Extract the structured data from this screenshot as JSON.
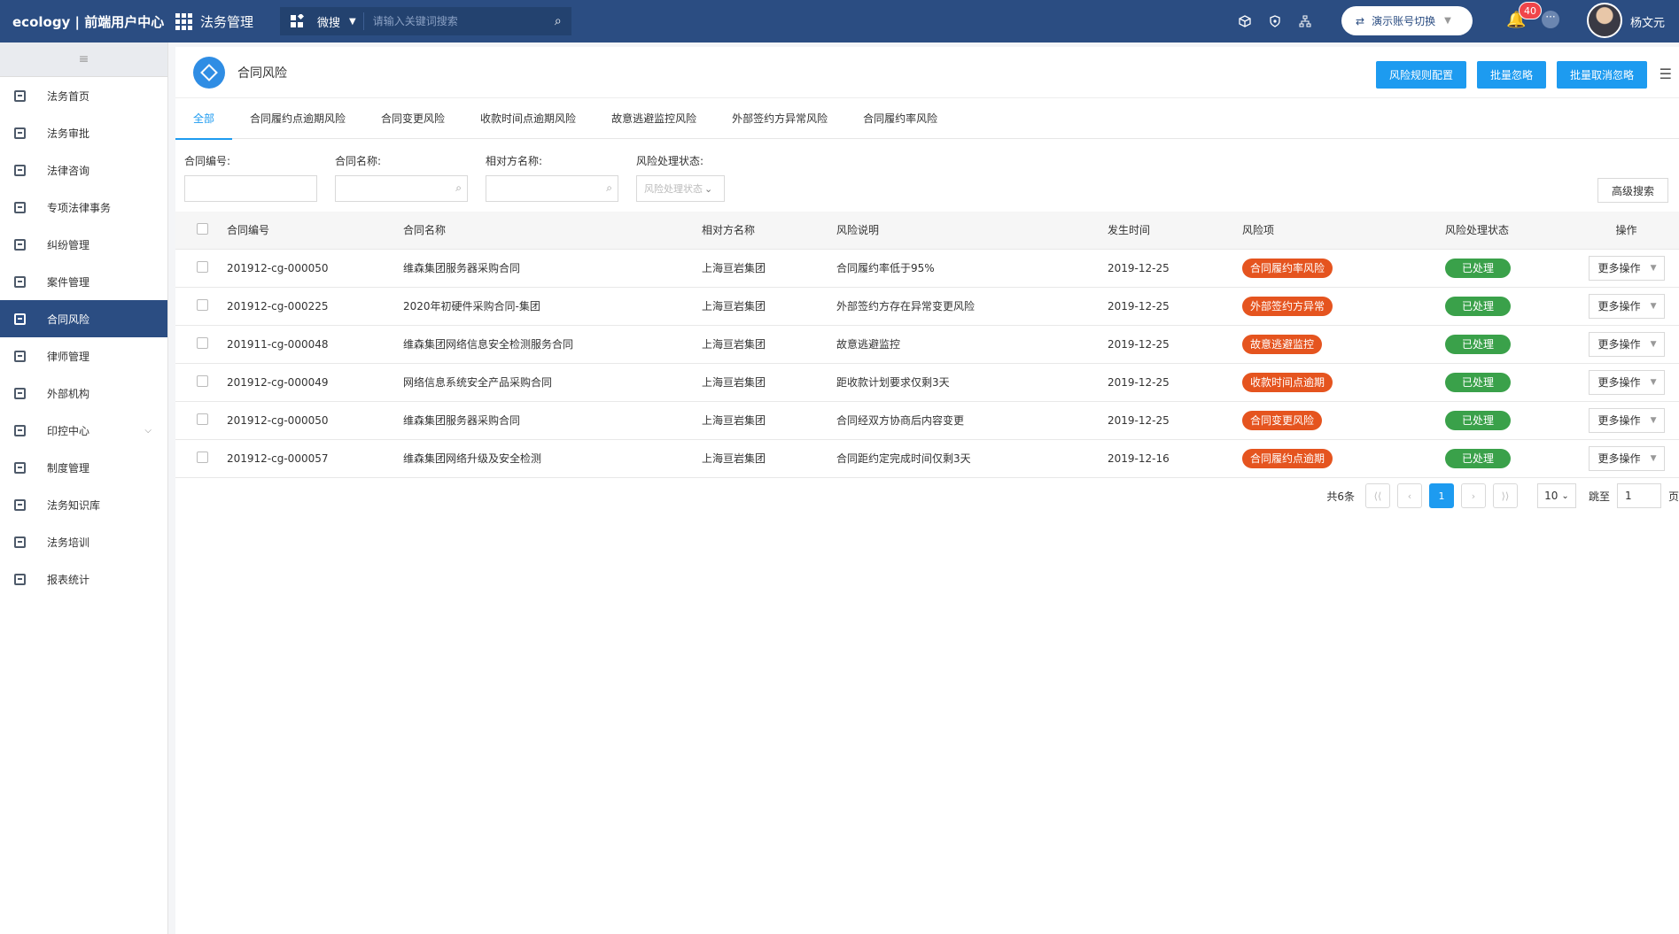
{
  "topbar": {
    "brand": "ecology | 前端用户中心",
    "module": "法务管理",
    "search_type": "微搜",
    "search_placeholder": "请输入关键词搜索",
    "account_switch": "演示账号切换",
    "notification_count": "40",
    "user_name": "杨文元"
  },
  "sidebar": {
    "items": [
      {
        "label": "法务首页"
      },
      {
        "label": "法务审批"
      },
      {
        "label": "法律咨询"
      },
      {
        "label": "专项法律事务"
      },
      {
        "label": "纠纷管理"
      },
      {
        "label": "案件管理"
      },
      {
        "label": "合同风险"
      },
      {
        "label": "律师管理"
      },
      {
        "label": "外部机构"
      },
      {
        "label": "印控中心"
      },
      {
        "label": "制度管理"
      },
      {
        "label": "法务知识库"
      },
      {
        "label": "法务培训"
      },
      {
        "label": "报表统计"
      }
    ]
  },
  "page": {
    "title": "合同风险",
    "buttons": {
      "config": "风险规则配置",
      "ignore": "批量忽略",
      "unignore": "批量取消忽略"
    }
  },
  "tabs": [
    "全部",
    "合同履约点逾期风险",
    "合同变更风险",
    "收款时间点逾期风险",
    "故意逃避监控风险",
    "外部签约方异常风险",
    "合同履约率风险"
  ],
  "filters": {
    "contract_no_label": "合同编号:",
    "contract_name_label": "合同名称:",
    "counterparty_label": "相对方名称:",
    "status_label": "风险处理状态:",
    "status_placeholder": "风险处理状态",
    "advanced": "高级搜索"
  },
  "table": {
    "headers": {
      "no": "合同编号",
      "name": "合同名称",
      "party": "相对方名称",
      "desc": "风险说明",
      "time": "发生时间",
      "risk": "风险项",
      "status": "风险处理状态",
      "op": "操作"
    },
    "rows": [
      {
        "no": "201912-cg-000050",
        "name": "维森集团服务器采购合同",
        "party": "上海亘岩集团",
        "desc": "合同履约率低于95%",
        "time": "2019-12-25",
        "risk": "合同履约率风险",
        "status": "已处理",
        "op": "更多操作"
      },
      {
        "no": "201912-cg-000225",
        "name": "2020年初硬件采购合同-集团",
        "party": "上海亘岩集团",
        "desc": "外部签约方存在异常变更风险",
        "time": "2019-12-25",
        "risk": "外部签约方异常",
        "status": "已处理",
        "op": "更多操作"
      },
      {
        "no": "201911-cg-000048",
        "name": "维森集团网络信息安全检测服务合同",
        "party": "上海亘岩集团",
        "desc": "故意逃避监控",
        "time": "2019-12-25",
        "risk": "故意逃避监控",
        "status": "已处理",
        "op": "更多操作"
      },
      {
        "no": "201912-cg-000049",
        "name": "网络信息系统安全产品采购合同",
        "party": "上海亘岩集团",
        "desc": "距收款计划要求仅剩3天",
        "time": "2019-12-25",
        "risk": "收款时间点逾期",
        "status": "已处理",
        "op": "更多操作"
      },
      {
        "no": "201912-cg-000050",
        "name": "维森集团服务器采购合同",
        "party": "上海亘岩集团",
        "desc": "合同经双方协商后内容变更",
        "time": "2019-12-25",
        "risk": "合同变更风险",
        "status": "已处理",
        "op": "更多操作"
      },
      {
        "no": "201912-cg-000057",
        "name": "维森集团网络升级及安全检测",
        "party": "上海亘岩集团",
        "desc": "合同距约定完成时间仅剩3天",
        "time": "2019-12-16",
        "risk": "合同履约点逾期",
        "status": "已处理",
        "op": "更多操作"
      }
    ]
  },
  "pagination": {
    "total": "共6条",
    "current_page": "1",
    "page_size": "10",
    "jump_label": "跳至",
    "jump_value": "1",
    "unit": "页"
  },
  "colors": {
    "header": "#2b4d82",
    "accent": "#1d9bf0",
    "risk": "#e5541f",
    "done": "#3aa14a"
  }
}
